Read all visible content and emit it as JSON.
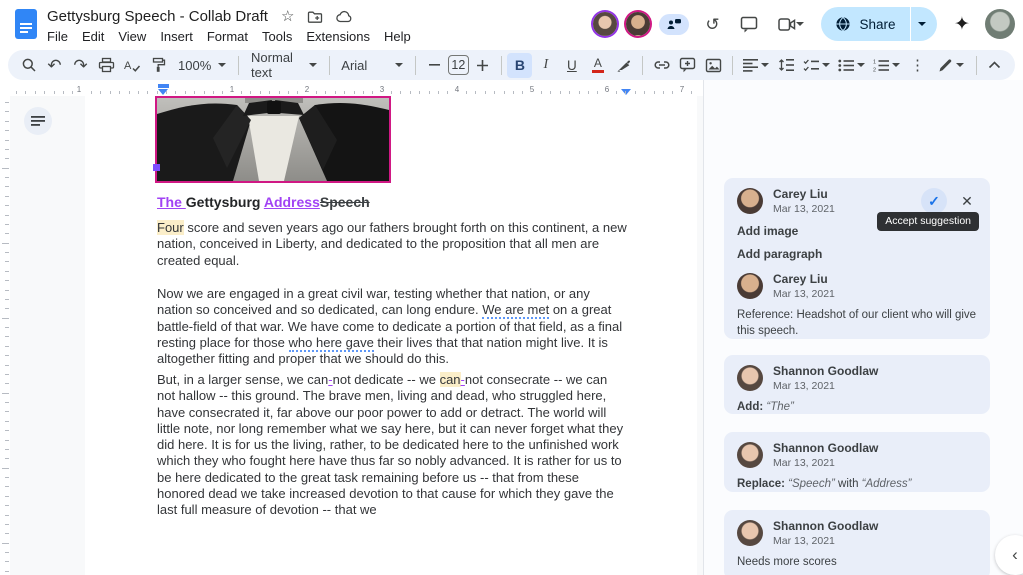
{
  "header": {
    "title": "Gettysburg Speech - Collab Draft",
    "menus": [
      "File",
      "Edit",
      "View",
      "Insert",
      "Format",
      "Tools",
      "Extensions",
      "Help"
    ],
    "share_label": "Share"
  },
  "toolbar": {
    "zoom_value": "100%",
    "paragraph_style": "Normal text",
    "font_name": "Arial",
    "font_size": "12",
    "bold_label": "B",
    "italic_label": "I",
    "underline_label": "U",
    "text_color_label": "A"
  },
  "icons": {
    "star": "☆",
    "undo": "↶",
    "redo": "↷",
    "history": "↺",
    "sparkle": "✦",
    "more_vert": "⋮",
    "check": "✓",
    "close": "✕",
    "chevron_left": "‹"
  },
  "ruler": {
    "labels": [
      "1",
      "1",
      "2",
      "3",
      "4",
      "5",
      "6",
      "7"
    ]
  },
  "document": {
    "heading": [
      {
        "t": "The ",
        "s": "ins"
      },
      {
        "t": "Gettysburg ",
        "s": ""
      },
      {
        "t": "Address",
        "s": "ins"
      },
      {
        "t": "Speech",
        "s": "del"
      }
    ],
    "paragraphs": [
      [
        {
          "t": "Four",
          "s": "hl"
        },
        {
          "t": " score and seven years ago our fathers brought forth on this continent, a new nation, conceived in Liberty, and dedicated to the proposition that all men are created equal.",
          "s": ""
        }
      ],
      [
        {
          "t": "Now we are engaged in a great civil war, testing whether that nation, or any nation so conceived and so dedicated, can long endure. ",
          "s": ""
        },
        {
          "t": "We are met",
          "s": "gram"
        },
        {
          "t": " on a great battle-field of that war. We have come to dedicate a portion of that field, as a final resting place for those ",
          "s": ""
        },
        {
          "t": "who here gave",
          "s": "gram"
        },
        {
          "t": " their lives that that nation might live. It is altogether fitting and proper that we should do this.",
          "s": ""
        }
      ],
      [
        {
          "t": "But, in a larger sense, we can",
          "s": ""
        },
        {
          "t": "-",
          "s": "ins"
        },
        {
          "t": "not dedicate -- we ",
          "s": ""
        },
        {
          "t": "can",
          "s": "hl"
        },
        {
          "t": "-",
          "s": "ins"
        },
        {
          "t": "not consecrate -- we can not hallow -- this ground. The brave men, living and dead, who struggled here, have consecrated it, far above our poor power to add or detract. The world will little note, nor long remember what we say here, but it can never forget what they did here. It is for us the living, rather, to be dedicated here to the unfinished work which they who fought here have thus far so nobly advanced. It is rather for us to be here dedicated to the great task remaining before us -- that from these honored dead we take increased devotion to that cause for which they gave the last full measure of devotion -- that we",
          "s": ""
        }
      ]
    ]
  },
  "comments": {
    "tooltip": "Accept suggestion",
    "cards": [
      {
        "author": "Carey Liu",
        "date": "Mar 13, 2021",
        "lines": [
          "Add image",
          "Add paragraph"
        ],
        "reply_author": "Carey Liu",
        "reply_date": "Mar 13, 2021",
        "reply_text": "Reference: Headshot of our client who will give this speech."
      },
      {
        "author": "Shannon Goodlaw",
        "date": "Mar 13, 2021",
        "body": [
          {
            "t": "Add: ",
            "s": "b"
          },
          {
            "t": "“The”",
            "s": "iq"
          }
        ]
      },
      {
        "author": "Shannon Goodlaw",
        "date": "Mar 13, 2021",
        "body": [
          {
            "t": "Replace: ",
            "s": "b"
          },
          {
            "t": "“Speech”",
            "s": "iq"
          },
          {
            "t": " with ",
            "s": ""
          },
          {
            "t": "“Address”",
            "s": "iq"
          }
        ]
      },
      {
        "author": "Shannon Goodlaw",
        "date": "Mar 13, 2021",
        "body": [
          {
            "t": "Needs more scores",
            "s": ""
          }
        ]
      }
    ]
  }
}
